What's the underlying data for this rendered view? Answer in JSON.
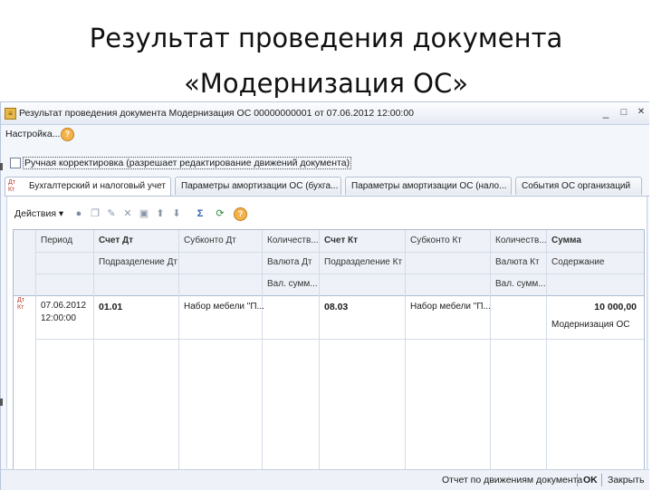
{
  "slide": {
    "title_line1": "Результат проведения документа",
    "title_line2": "«Модернизация ОС»"
  },
  "window": {
    "title": "Результат проведения документа Модернизация ОС 00000000001 от 07.06.2012 12:00:00",
    "minimize": "_",
    "maximize": "□",
    "close": "✕"
  },
  "menu": {
    "settings": "Настройка..."
  },
  "manual_edit": {
    "label": "Ручная корректировка (разрешает редактирование движений документа)",
    "checked": false
  },
  "tabs": [
    {
      "label": "Бухгалтерский и налоговый учет",
      "active": true
    },
    {
      "label": "Параметры амортизации ОС (бухга..."
    },
    {
      "label": "Параметры амортизации ОС (нало..."
    },
    {
      "label": "События ОС организаций"
    }
  ],
  "toolbar": {
    "actions": "Действия ▾"
  },
  "icons": {
    "help": "question-icon",
    "tab": "dt-kt-icon",
    "toolbar": [
      "add-icon",
      "copy-icon",
      "edit-icon",
      "delete-icon",
      "save-icon",
      "move-up-icon",
      "move-down-icon",
      "sum-icon",
      "refresh-icon",
      "help-icon"
    ]
  },
  "table": {
    "headers_row1": [
      "Период",
      "Счет Дт",
      "Субконто Дт",
      "Количеств...",
      "Счет Кт",
      "Субконто Кт",
      "Количеств...",
      "Сумма"
    ],
    "headers_row2": [
      "",
      "Подразделение Дт",
      "",
      "Валюта Дт",
      "Подразделение Кт",
      "",
      "Валюта Кт",
      "Содержание"
    ],
    "headers_row3": [
      "",
      "",
      "",
      "Вал. сумм...",
      "",
      "",
      "Вал. сумм...",
      ""
    ],
    "rows": [
      {
        "date": "07.06.2012",
        "time": "12:00:00",
        "account_dt": "01.01",
        "subconto_dt": "Набор мебели \"П...",
        "account_kt": "08.03",
        "subconto_kt": "Набор мебели \"П...",
        "amount": "10 000,00",
        "content": "Модернизация ОС"
      }
    ]
  },
  "bottom": {
    "report": "Отчет по движениям документа",
    "ok": "OK",
    "close": "Закрыть"
  }
}
